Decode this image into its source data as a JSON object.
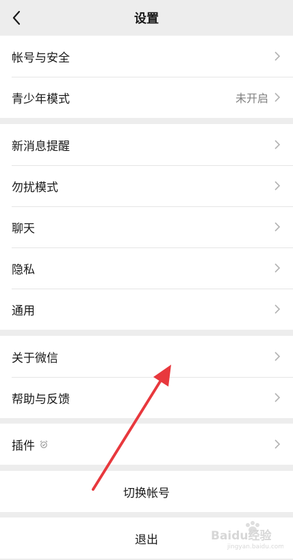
{
  "nav": {
    "title": "设置"
  },
  "groups": {
    "g1": [
      {
        "label": "帐号与安全",
        "value": ""
      },
      {
        "label": "青少年模式",
        "value": "未开启"
      }
    ],
    "g2": [
      {
        "label": "新消息提醒"
      },
      {
        "label": "勿扰模式"
      },
      {
        "label": "聊天"
      },
      {
        "label": "隐私"
      },
      {
        "label": "通用"
      }
    ],
    "g3": [
      {
        "label": "关于微信"
      },
      {
        "label": "帮助与反馈"
      }
    ],
    "g4": [
      {
        "label": "插件"
      }
    ]
  },
  "actions": {
    "switch_account": "切换帐号",
    "logout": "退出"
  },
  "watermark": {
    "brand": "Baidu经验",
    "url": "jingyan.baidu.com"
  },
  "colors": {
    "annotation_arrow": "#e8383d",
    "background": "#ededed"
  }
}
